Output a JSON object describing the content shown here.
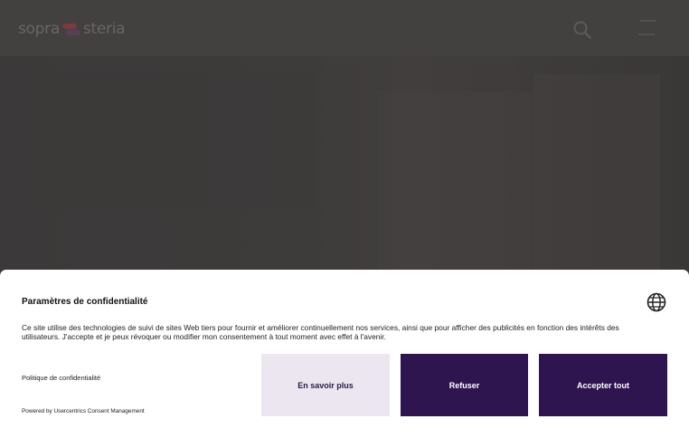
{
  "header": {
    "logo_left": "sopra",
    "logo_right": "steria",
    "search_icon": "search-icon",
    "menu_icon": "hamburger-menu-icon"
  },
  "consent": {
    "title": "Paramètres de confidentialité",
    "description": "Ce site utilise des technologies de suivi de sites Web tiers pour fournir et améliorer continuellement nos services, ainsi que pour afficher des publicités en fonction des intérêts des utilisateurs. J'accepte et je peux révoquer ou modifier mon consentement à tout moment avec effet à l'avenir.",
    "language_icon": "globe-icon",
    "privacy_link": "Politique de confidentialité",
    "powered_by": "Powered by Usercentrics Consent Management",
    "buttons": {
      "more": "En savoir plus",
      "refuse": "Refuser",
      "accept": "Accepter tout"
    }
  },
  "colors": {
    "overlay": "#3a3838",
    "primary_button": "#2e1550",
    "secondary_button": "#ebe6f0",
    "logo_accent": "#a3323e"
  }
}
